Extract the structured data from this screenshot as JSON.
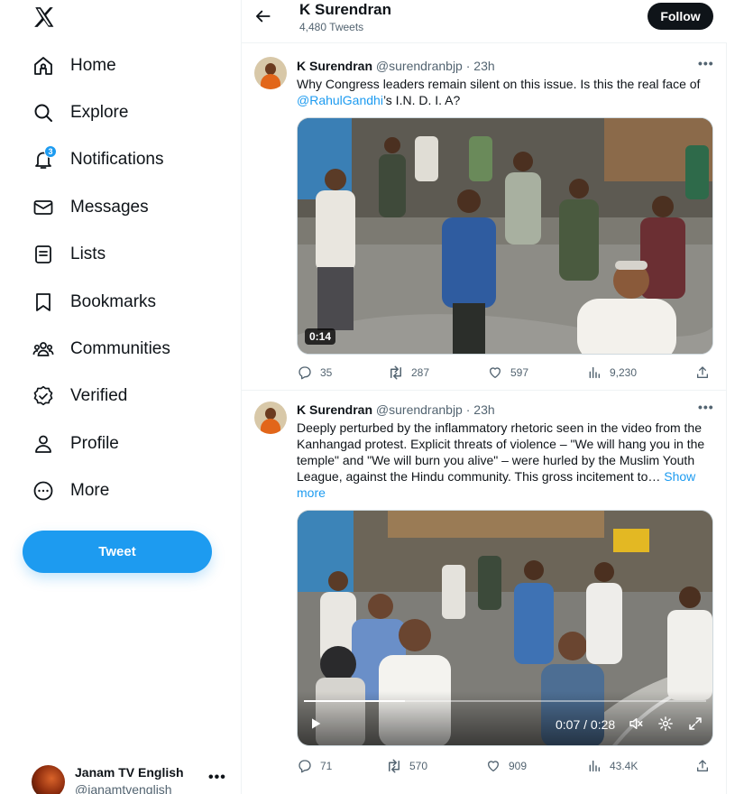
{
  "sidebar": {
    "nav": [
      {
        "label": "Home"
      },
      {
        "label": "Explore"
      },
      {
        "label": "Notifications",
        "badge": "3"
      },
      {
        "label": "Messages"
      },
      {
        "label": "Lists"
      },
      {
        "label": "Bookmarks"
      },
      {
        "label": "Communities"
      },
      {
        "label": "Verified"
      },
      {
        "label": "Profile"
      },
      {
        "label": "More"
      }
    ],
    "tweet_button": "Tweet",
    "account": {
      "name": "Janam TV English",
      "handle": "@janamtvenglish",
      "more": "•••"
    }
  },
  "header": {
    "title": "K Surendran",
    "tweet_count": "4,480 Tweets",
    "follow_label": "Follow"
  },
  "tweets": [
    {
      "name": "K Surendran",
      "handle": "@surendranbjp · 23h",
      "more": "•••",
      "text_before": "Why Congress leaders remain silent on this issue. Is this the real face of ",
      "mention": "@RahulGandhi",
      "text_after": "’s I.N. D. I. A?",
      "video_duration": "0:14",
      "stats": {
        "replies": "35",
        "retweets": "287",
        "likes": "597",
        "views": "9,230"
      }
    },
    {
      "name": "K Surendran",
      "handle": "@surendranbjp · 23h",
      "more": "•••",
      "text": "Deeply perturbed by the inflammatory rhetoric seen in the video from the Kanhangad protest. Explicit threats of violence – \"We will hang you in the temple\" and \"We will burn you alive\" – were hurled by the Muslim Youth League, against the Hindu community. This gross incitement to… ",
      "show_more": "Show more",
      "video_time": "0:07 / 0:28",
      "video_progress": 0.25,
      "stats": {
        "replies": "71",
        "retweets": "570",
        "likes": "909",
        "views": "43.4K"
      }
    }
  ],
  "colors": {
    "accent": "#1d9bf0",
    "text": "#0f1419",
    "secondary": "#536471",
    "border": "#eff3f4"
  }
}
